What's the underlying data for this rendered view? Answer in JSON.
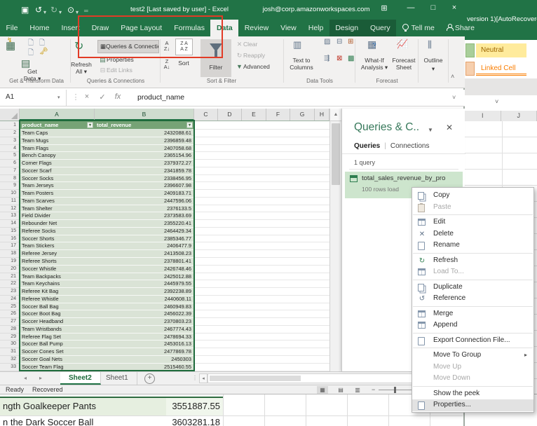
{
  "title_bar": {
    "title": "test2 [Last saved by user] - Excel",
    "account": "josh@corp.amazonworkspaces.com"
  },
  "background_window": {
    "title_fragment": "version 1)[AutoRecovere",
    "style_chips": [
      {
        "label": "Neutral",
        "bg": "#ffeb9c",
        "color": "#9c6500"
      },
      {
        "label": "Linked Cell",
        "bg": "#ffffff",
        "color": "#fa7d00"
      }
    ],
    "columns": [
      "I",
      "J"
    ],
    "bottom_rows": [
      {
        "name": "ngth Goalkeeper Pants",
        "value": "3551887.55",
        "highlight": true
      },
      {
        "name": "n the Dark Soccer Ball",
        "value": "3603281.18",
        "highlight": false
      }
    ]
  },
  "ribbon_tabs": [
    {
      "label": "File",
      "style": "file"
    },
    {
      "label": "Home"
    },
    {
      "label": "Insert"
    },
    {
      "label": "Draw"
    },
    {
      "label": "Page Layout"
    },
    {
      "label": "Formulas"
    },
    {
      "label": "Data",
      "style": "active"
    },
    {
      "label": "Review"
    },
    {
      "label": "View"
    },
    {
      "label": "Help"
    },
    {
      "label": "Design",
      "style": "contextual"
    },
    {
      "label": "Query",
      "style": "contextual"
    },
    {
      "label": "Tell me",
      "style": "tellme"
    },
    {
      "label": "Share",
      "style": "share"
    }
  ],
  "ribbon": {
    "get_data": "Get\nData ▾",
    "refresh_all": "Refresh\nAll ▾",
    "queries_connections": "Queries & Connections",
    "properties": "Properties",
    "edit_links": "Edit Links",
    "sort": "Sort",
    "filter": "Filter",
    "clear": "Clear",
    "reapply": "Reapply",
    "advanced": "Advanced",
    "text_to_columns": "Text to\nColumns",
    "what_if": "What-If\nAnalysis ▾",
    "forecast_sheet": "Forecast\nSheet",
    "outline": "Outline",
    "groups": {
      "g1": "Get & Transform Data",
      "g2": "Queries & Connections",
      "g3": "Sort & Filter",
      "g4": "Data Tools",
      "g5": "Forecast"
    }
  },
  "formula_bar": {
    "name_box": "A1",
    "fx_label": "fx",
    "content": "product_name"
  },
  "sheet": {
    "columns": [
      "A",
      "B",
      "C",
      "D",
      "E",
      "F",
      "G",
      "H"
    ],
    "header": {
      "n": 1,
      "name": "product_name",
      "value": "total_revenue"
    },
    "rows": [
      {
        "n": 2,
        "name": "Team Caps",
        "value": "2432088.61"
      },
      {
        "n": 3,
        "name": "Team Mugs",
        "value": "2396859.48"
      },
      {
        "n": 4,
        "name": "Team Flags",
        "value": "2407058.68"
      },
      {
        "n": 5,
        "name": "Bench Canopy",
        "value": "2365154.96"
      },
      {
        "n": 6,
        "name": "Corner Flags",
        "value": "2379372.27"
      },
      {
        "n": 7,
        "name": "Soccer Scarf",
        "value": "2341859.78"
      },
      {
        "n": 8,
        "name": "Soccer Socks",
        "value": "2338456.95"
      },
      {
        "n": 9,
        "name": "Team Jerseys",
        "value": "2396607.98"
      },
      {
        "n": 10,
        "name": "Team Posters",
        "value": "2409183.71"
      },
      {
        "n": 11,
        "name": "Team Scarves",
        "value": "2447596.06"
      },
      {
        "n": 12,
        "name": "Team Shelter",
        "value": "2376133.5"
      },
      {
        "n": 13,
        "name": "Field Divider",
        "value": "2373583.69"
      },
      {
        "n": 14,
        "name": "Rebounder Net",
        "value": "2355220.41"
      },
      {
        "n": 15,
        "name": "Referee Socks",
        "value": "2464429.34"
      },
      {
        "n": 16,
        "name": "Soccer Shorts",
        "value": "2385346.77"
      },
      {
        "n": 17,
        "name": "Team Stickers",
        "value": "2406477.9"
      },
      {
        "n": 18,
        "name": "Referee Jersey",
        "value": "2413508.23"
      },
      {
        "n": 19,
        "name": "Referee Shorts",
        "value": "2378801.41"
      },
      {
        "n": 20,
        "name": "Soccer Whistle",
        "value": "2426748.46"
      },
      {
        "n": 21,
        "name": "Team Backpacks",
        "value": "2425012.88"
      },
      {
        "n": 22,
        "name": "Team Keychains",
        "value": "2445979.55"
      },
      {
        "n": 23,
        "name": "Referee Kit Bag",
        "value": "2392238.89"
      },
      {
        "n": 24,
        "name": "Referee Whistle",
        "value": "2440608.11"
      },
      {
        "n": 25,
        "name": "Soccer Ball Bag",
        "value": "2460949.83"
      },
      {
        "n": 26,
        "name": "Soccer Boot Bag",
        "value": "2456022.39"
      },
      {
        "n": 27,
        "name": "Soccer Headband",
        "value": "2370803.23"
      },
      {
        "n": 28,
        "name": "Team Wristbands",
        "value": "2467774.43"
      },
      {
        "n": 29,
        "name": "Referee Flag Set",
        "value": "2478694.33"
      },
      {
        "n": 30,
        "name": "Soccer Ball Pump",
        "value": "2453016.13"
      },
      {
        "n": 31,
        "name": "Soccer Cones Set",
        "value": "2477869.78"
      },
      {
        "n": 32,
        "name": "Soccer Goal Nets",
        "value": "2450303"
      },
      {
        "n": 33,
        "name": "Soccer Team Flag",
        "value": "2515460.55"
      }
    ]
  },
  "queries_pane": {
    "title": "Queries & C..",
    "tab_queries": "Queries",
    "tab_connections": "Connections",
    "count_label": "1 query",
    "query_name": "total_sales_revenue_by_pro",
    "query_sub": "100 rows load"
  },
  "context_menu": {
    "items": [
      {
        "label": "Copy",
        "icon": "copy-icon"
      },
      {
        "label": "Paste",
        "icon": "paste-icon",
        "disabled": true,
        "sep": true
      },
      {
        "label": "Edit",
        "icon": "edit-icon"
      },
      {
        "label": "Delete",
        "icon": "delete-icon"
      },
      {
        "label": "Rename",
        "icon": "rename-icon",
        "sep": true
      },
      {
        "label": "Refresh",
        "icon": "refresh-icon"
      },
      {
        "label": "Load To...",
        "icon": "load-to-icon",
        "disabled": true,
        "sep": true
      },
      {
        "label": "Duplicate",
        "icon": "duplicate-icon"
      },
      {
        "label": "Reference",
        "icon": "reference-icon",
        "sep": true
      },
      {
        "label": "Merge",
        "icon": "merge-icon"
      },
      {
        "label": "Append",
        "icon": "append-icon",
        "sep": true
      },
      {
        "label": "Export Connection File...",
        "icon": "export-icon",
        "sep": true
      },
      {
        "label": "Move To Group",
        "submenu": true
      },
      {
        "label": "Move Up",
        "disabled": true
      },
      {
        "label": "Move Down",
        "disabled": true,
        "sep": true
      },
      {
        "label": "Show the peek"
      },
      {
        "label": "Properties...",
        "icon": "properties-icon",
        "highlighted": true
      }
    ]
  },
  "sheet_tabs": {
    "active": "Sheet2",
    "other": "Sheet1"
  },
  "status_bar": {
    "mode": "Ready",
    "extra": "Recovered"
  },
  "annotation": {
    "color": "#e23b26"
  }
}
